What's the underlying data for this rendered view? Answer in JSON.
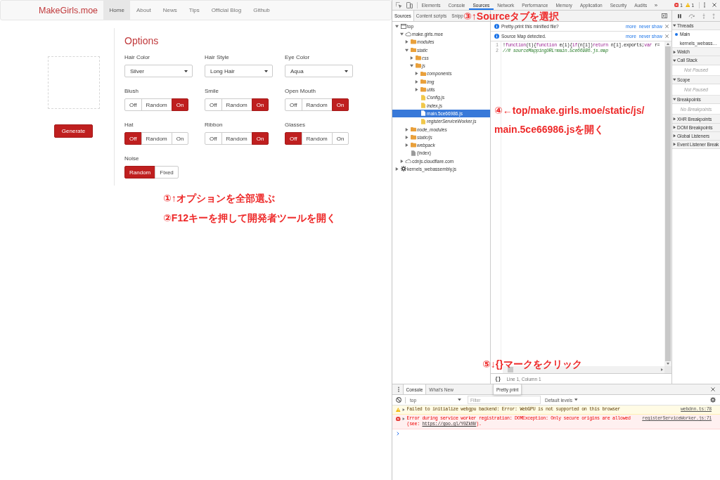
{
  "page": {
    "navbar": {
      "brand": "MakeGirls.moe",
      "links": [
        {
          "label": "Home",
          "selected": true
        },
        {
          "label": "About",
          "selected": false
        },
        {
          "label": "News",
          "selected": false
        },
        {
          "label": "Tips",
          "selected": false
        },
        {
          "label": "Official Blog",
          "selected": false
        },
        {
          "label": "Github",
          "selected": false
        }
      ]
    },
    "generate_button": "Generate",
    "options": {
      "title": "Options",
      "fields": [
        {
          "kind": "select",
          "label": "Hair Color",
          "value": "Silver"
        },
        {
          "kind": "select",
          "label": "Hair Style",
          "value": "Long Hair"
        },
        {
          "kind": "select",
          "label": "Eye Color",
          "value": "Aqua"
        },
        {
          "kind": "toggle",
          "label": "Blush",
          "choices": [
            {
              "label": "Off",
              "selected": false
            },
            {
              "label": "Random",
              "selected": false
            },
            {
              "label": "On",
              "selected": true
            }
          ]
        },
        {
          "kind": "toggle",
          "label": "Smile",
          "choices": [
            {
              "label": "Off",
              "selected": false
            },
            {
              "label": "Random",
              "selected": false
            },
            {
              "label": "On",
              "selected": true
            }
          ]
        },
        {
          "kind": "toggle",
          "label": "Open Mouth",
          "choices": [
            {
              "label": "Off",
              "selected": false
            },
            {
              "label": "Random",
              "selected": false
            },
            {
              "label": "On",
              "selected": true
            }
          ]
        },
        {
          "kind": "toggle",
          "label": "Hat",
          "choices": [
            {
              "label": "Off",
              "selected": true
            },
            {
              "label": "Random",
              "selected": false
            },
            {
              "label": "On",
              "selected": false
            }
          ]
        },
        {
          "kind": "toggle",
          "label": "Ribbon",
          "choices": [
            {
              "label": "Off",
              "selected": false
            },
            {
              "label": "Random",
              "selected": false
            },
            {
              "label": "On",
              "selected": true
            }
          ]
        },
        {
          "kind": "toggle",
          "label": "Glasses",
          "choices": [
            {
              "label": "Off",
              "selected": true
            },
            {
              "label": "Random",
              "selected": false
            },
            {
              "label": "On",
              "selected": false
            }
          ]
        },
        {
          "kind": "toggle",
          "label": "Noise",
          "choices": [
            {
              "label": "Random",
              "selected": true
            },
            {
              "label": "Fixed",
              "selected": false
            }
          ]
        }
      ]
    }
  },
  "devtools": {
    "tabs": [
      {
        "label": "Elements",
        "selected": false
      },
      {
        "label": "Console",
        "selected": false
      },
      {
        "label": "Sources",
        "selected": true
      },
      {
        "label": "Network",
        "selected": false
      },
      {
        "label": "Performance",
        "selected": false
      },
      {
        "label": "Memory",
        "selected": false
      },
      {
        "label": "Application",
        "selected": false
      },
      {
        "label": "Security",
        "selected": false
      },
      {
        "label": "Audits",
        "selected": false
      }
    ],
    "more_tabs": "»",
    "error_count": "1",
    "warning_count": "1",
    "navigator": {
      "tabs": [
        {
          "label": "Sources",
          "selected": true
        },
        {
          "label": "Content scripts",
          "selected": false
        },
        {
          "label": "Snipp",
          "selected": false
        }
      ],
      "tree": [
        {
          "name": "top",
          "kind": "frame",
          "expanded": true,
          "italic": false,
          "selected": false,
          "children": [
            {
              "name": "make.girls.moe",
              "kind": "domain",
              "expanded": true,
              "italic": false,
              "selected": false,
              "children": [
                {
                  "name": "modules",
                  "kind": "folder",
                  "expanded": false,
                  "italic": true,
                  "selected": false
                },
                {
                  "name": "static",
                  "kind": "folder",
                  "expanded": true,
                  "italic": true,
                  "selected": false,
                  "children": [
                    {
                      "name": "css",
                      "kind": "folder",
                      "expanded": false,
                      "italic": true,
                      "selected": false
                    },
                    {
                      "name": "js",
                      "kind": "folder",
                      "expanded": true,
                      "italic": true,
                      "selected": false,
                      "children": [
                        {
                          "name": "components",
                          "kind": "folder",
                          "expanded": false,
                          "italic": true,
                          "selected": false
                        },
                        {
                          "name": "img",
                          "kind": "folder",
                          "expanded": false,
                          "italic": true,
                          "selected": false
                        },
                        {
                          "name": "utils",
                          "kind": "folder",
                          "expanded": false,
                          "italic": true,
                          "selected": false
                        },
                        {
                          "name": "Config.js",
                          "kind": "script",
                          "italic": true,
                          "selected": false
                        },
                        {
                          "name": "index.js",
                          "kind": "script",
                          "italic": true,
                          "selected": false
                        },
                        {
                          "name": "main.5ce66986.js",
                          "kind": "script",
                          "italic": false,
                          "selected": true
                        },
                        {
                          "name": "registerServiceWorker.js",
                          "kind": "script",
                          "italic": true,
                          "selected": false
                        }
                      ]
                    }
                  ]
                },
                {
                  "name": "node_modules",
                  "kind": "folder",
                  "expanded": false,
                  "italic": true,
                  "selected": false
                },
                {
                  "name": "static/js",
                  "kind": "folder",
                  "expanded": false,
                  "italic": true,
                  "selected": false
                },
                {
                  "name": "webpack",
                  "kind": "folder",
                  "expanded": false,
                  "italic": true,
                  "selected": false
                },
                {
                  "name": "(index)",
                  "kind": "document",
                  "italic": false,
                  "selected": false
                }
              ]
            },
            {
              "name": "cdnjs.cloudflare.com",
              "kind": "domain",
              "expanded": false,
              "italic": false,
              "selected": false
            }
          ]
        },
        {
          "name": "kernels_webassembly.js",
          "kind": "worker",
          "expanded": false,
          "italic": false,
          "selected": false
        }
      ]
    },
    "editor": {
      "infobars": [
        {
          "message": "Pretty-print this minified file?",
          "links": [
            "more",
            "never show"
          ]
        },
        {
          "message": "Source Map detected.",
          "links": [
            "more",
            "never show"
          ]
        }
      ],
      "lines": [
        {
          "number": "1",
          "tokens": [
            {
              "kind": "plain",
              "text": "!"
            },
            {
              "kind": "keyword",
              "text": "function"
            },
            {
              "kind": "plain",
              "text": "(t){"
            },
            {
              "kind": "keyword",
              "text": "function"
            },
            {
              "kind": "plain",
              "text": " e(i){"
            },
            {
              "kind": "keyword",
              "text": "if"
            },
            {
              "kind": "plain",
              "text": "(n[i])"
            },
            {
              "kind": "keyword",
              "text": "return"
            },
            {
              "kind": "plain",
              "text": " n[i].exports;"
            },
            {
              "kind": "keyword",
              "text": "var"
            },
            {
              "kind": "plain",
              "text": " r="
            }
          ]
        },
        {
          "number": "2",
          "tokens": [
            {
              "kind": "comment",
              "text": "//# sourceMappingURL=main.5ce66986.js.map"
            }
          ]
        }
      ],
      "pretty_print": "{}",
      "cursor": "Line 1, Column 1",
      "tooltip": "Pretty print"
    },
    "debugger": {
      "sections": [
        {
          "title": "Threads",
          "expanded": true,
          "threads": [
            {
              "name": "Main",
              "selected": true
            },
            {
              "name": "kernels_webass…",
              "selected": false
            }
          ]
        },
        {
          "title": "Watch",
          "expanded": false
        },
        {
          "title": "Call Stack",
          "expanded": true,
          "message": "Not Paused"
        },
        {
          "title": "Scope",
          "expanded": true,
          "message": "Not Paused"
        },
        {
          "title": "Breakpoints",
          "expanded": true,
          "message": "No Breakpoints"
        },
        {
          "title": "XHR Breakpoints",
          "expanded": false
        },
        {
          "title": "DOM Breakpoints",
          "expanded": false
        },
        {
          "title": "Global Listeners",
          "expanded": false
        },
        {
          "title": "Event Listener Break",
          "expanded": false
        }
      ]
    },
    "drawer": {
      "tabs": [
        {
          "label": "Console",
          "selected": true
        },
        {
          "label": "What's New",
          "selected": false
        }
      ],
      "context": "top",
      "filter": {
        "placeholder": "Filter"
      },
      "levels": "Default levels",
      "messages": [
        {
          "kind": "warning",
          "text": "Failed to initialize webgpu backend: Error: WebGPU is not supported on this browser",
          "source": "webdnn.ts:78"
        },
        {
          "kind": "error",
          "text": "Error during service worker registration: DOMException: Only secure origins are allowed (see: ",
          "link": "https://goo.gl/Y0ZkNV",
          "text_end": ").",
          "source": "registerServiceWorker.js:71"
        }
      ]
    }
  },
  "annotations": [
    {
      "lines": [
        "①↑オプションを全部選ぶ"
      ]
    },
    {
      "lines": [
        "②F12キーを押して開発者ツールを開く"
      ]
    },
    {
      "lines": [
        "③↑Sourceタブを選択"
      ]
    },
    {
      "lines": [
        "④←top/make.girls.moe/static/js/",
        "main.5ce66986.jsを開く"
      ]
    },
    {
      "lines": [
        "⑤↓{}マークをクリック"
      ]
    }
  ]
}
